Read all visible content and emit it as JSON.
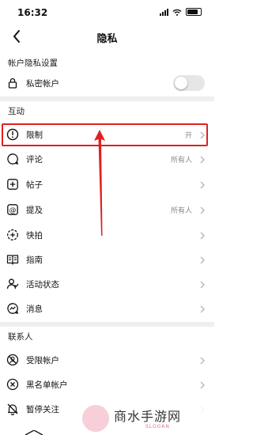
{
  "status": {
    "time": "16:32"
  },
  "nav": {
    "title": "隐私"
  },
  "sections": {
    "account": "帐户隐私设置",
    "interaction": "互动",
    "contacts": "联系人"
  },
  "account_rows": [
    {
      "label": "私密帐户",
      "icon": "lock-icon",
      "toggle_on": false
    }
  ],
  "interaction_rows": [
    {
      "label": "限制",
      "value": "开",
      "icon": "restrict-icon"
    },
    {
      "label": "评论",
      "value": "所有人",
      "icon": "comment-icon"
    },
    {
      "label": "帖子",
      "value": "",
      "icon": "post-icon"
    },
    {
      "label": "提及",
      "value": "所有人",
      "icon": "mention-icon"
    },
    {
      "label": "快拍",
      "value": "",
      "icon": "story-icon"
    },
    {
      "label": "指南",
      "value": "",
      "icon": "guide-icon"
    },
    {
      "label": "活动状态",
      "value": "",
      "icon": "activity-status-icon"
    },
    {
      "label": "消息",
      "value": "",
      "icon": "messenger-icon"
    }
  ],
  "contact_rows": [
    {
      "label": "受限帐户",
      "icon": "restricted-account-icon"
    },
    {
      "label": "黑名单帐户",
      "icon": "blocked-account-icon"
    },
    {
      "label": "暂停关注",
      "icon": "mute-bell-icon"
    }
  ],
  "watermark": {
    "text": "商水手游网",
    "sub": "SLOGAN"
  },
  "colors": {
    "highlight": "#e02020",
    "arrow": "#e02020",
    "divider": "#efefef",
    "value_text": "#888888"
  }
}
